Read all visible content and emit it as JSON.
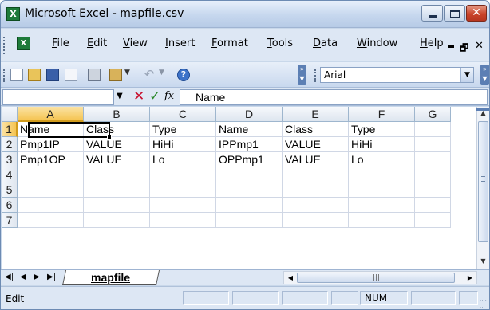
{
  "window": {
    "title": "Microsoft Excel - mapfile.csv",
    "app_icon_glyph": "X",
    "close_glyph": "✕"
  },
  "menubar": {
    "items": [
      "File",
      "Edit",
      "View",
      "Insert",
      "Format",
      "Tools",
      "Data",
      "Window",
      "Help"
    ],
    "doc_restore_glyph": "🗗",
    "doc_close_glyph": "✕"
  },
  "toolbar": {
    "font_name": "Arial",
    "help_glyph": "?",
    "undo_glyph": "↶"
  },
  "formula_bar": {
    "name_box": "",
    "cancel_glyph": "✕",
    "enter_glyph": "✓",
    "fx_glyph": "fx",
    "content": "Name"
  },
  "sheet": {
    "columns": [
      "A",
      "B",
      "C",
      "D",
      "E",
      "F",
      "G"
    ],
    "rows": [
      "1",
      "2",
      "3",
      "4",
      "5",
      "6",
      "7"
    ],
    "cells": [
      [
        "Name",
        "Class",
        "Type",
        "Name",
        "Class",
        "Type"
      ],
      [
        "Pmp1IP",
        "VALUE",
        "HiHi",
        "IPPmp1",
        "VALUE",
        "HiHi"
      ],
      [
        "Pmp1OP",
        "VALUE",
        "Lo",
        "OPPmp1",
        "VALUE",
        "Lo"
      ]
    ],
    "active_cell": "A1",
    "tab_name": "mapfile"
  },
  "tab_nav": {
    "first": "◀|",
    "prev": "◀",
    "next": "▶",
    "last": "▶|"
  },
  "scroll": {
    "left_arrow": "◀",
    "right_arrow": "▶",
    "up_arrow": "▲",
    "down_arrow": "▼",
    "h_grip": "|||"
  },
  "status": {
    "mode": "Edit",
    "num_lock": "NUM"
  },
  "colors": {
    "selected_header": "#f5c451",
    "grid_line": "#d0d7e5",
    "excel_green": "#1e7b3a"
  }
}
